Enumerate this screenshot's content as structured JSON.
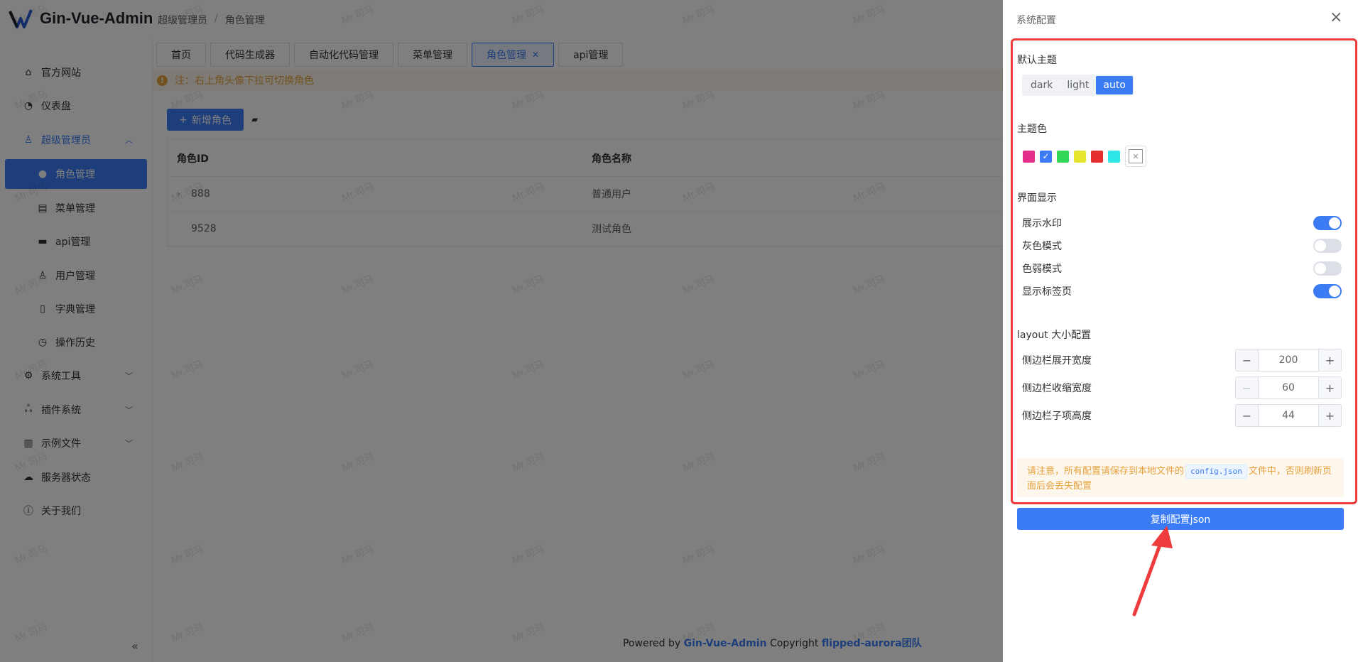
{
  "app": {
    "title": "Gin-Vue-Admin"
  },
  "breadcrumb": [
    "超级管理员",
    "/",
    "角色管理"
  ],
  "sidebar": {
    "items": [
      {
        "label": "官方网站",
        "icon": "home-icon"
      },
      {
        "label": "仪表盘",
        "icon": "dashboard-icon"
      },
      {
        "label": "超级管理员",
        "icon": "user-icon"
      },
      {
        "label": "角色管理",
        "icon": "avatar-icon"
      },
      {
        "label": "菜单管理",
        "icon": "document-icon"
      },
      {
        "label": "api管理",
        "icon": "monitor-icon"
      },
      {
        "label": "用户管理",
        "icon": "user-outline-icon"
      },
      {
        "label": "字典管理",
        "icon": "book-icon"
      },
      {
        "label": "操作历史",
        "icon": "clock-icon"
      },
      {
        "label": "系统工具",
        "icon": "gear-icon"
      },
      {
        "label": "插件系统",
        "icon": "cherry-icon"
      },
      {
        "label": "示例文件",
        "icon": "files-icon"
      },
      {
        "label": "服务器状态",
        "icon": "cloud-icon"
      },
      {
        "label": "关于我们",
        "icon": "info-icon"
      }
    ]
  },
  "tabs": [
    {
      "label": "首页"
    },
    {
      "label": "代码生成器"
    },
    {
      "label": "自动化代码管理"
    },
    {
      "label": "菜单管理"
    },
    {
      "label": "角色管理"
    },
    {
      "label": "api管理"
    }
  ],
  "notice": {
    "text": "注：右上角头像下拉可切换角色"
  },
  "toolbar": {
    "add_label": "新增角色"
  },
  "table": {
    "headers": [
      "角色ID",
      "角色名称"
    ],
    "rows": [
      {
        "id": "888",
        "name": "普通用户"
      },
      {
        "id": "9528",
        "name": "测试角色"
      }
    ]
  },
  "footer": {
    "prefix": "Powered by",
    "brand": "Gin-Vue-Admin",
    "copyright": "Copyright",
    "team": "flipped-aurora团队"
  },
  "watermark": {
    "text": "Mr.司马"
  },
  "drawer": {
    "title": "系统配置",
    "theme": {
      "title": "默认主题",
      "options": [
        "dark",
        "light",
        "auto"
      ],
      "selected": "auto"
    },
    "colors": {
      "title": "主题色",
      "swatches": [
        "#e62e8c",
        "#3b7cf4",
        "#33d659",
        "#e6e62e",
        "#e62e2e",
        "#2ee6e6"
      ],
      "selected": "#3b7cf4"
    },
    "display": {
      "title": "界面显示",
      "toggles": [
        {
          "label": "展示水印",
          "on": true
        },
        {
          "label": "灰色模式",
          "on": false
        },
        {
          "label": "色弱模式",
          "on": false
        },
        {
          "label": "显示标签页",
          "on": true
        }
      ]
    },
    "layout": {
      "title": "layout 大小配置",
      "fields": [
        {
          "label": "侧边栏展开宽度",
          "value": "200"
        },
        {
          "label": "侧边栏收缩宽度",
          "value": "60"
        },
        {
          "label": "侧边栏子项高度",
          "value": "44"
        }
      ]
    },
    "tip": {
      "before": "请注意，所有配置请保存到本地文件的",
      "code": "config.json",
      "after": "文件中，否则刷新页面后会丢失配置"
    },
    "copy_label": "复制配置json"
  },
  "colors": {
    "primary": "#3b7cf4",
    "annotation_red": "#ee3b3b"
  }
}
